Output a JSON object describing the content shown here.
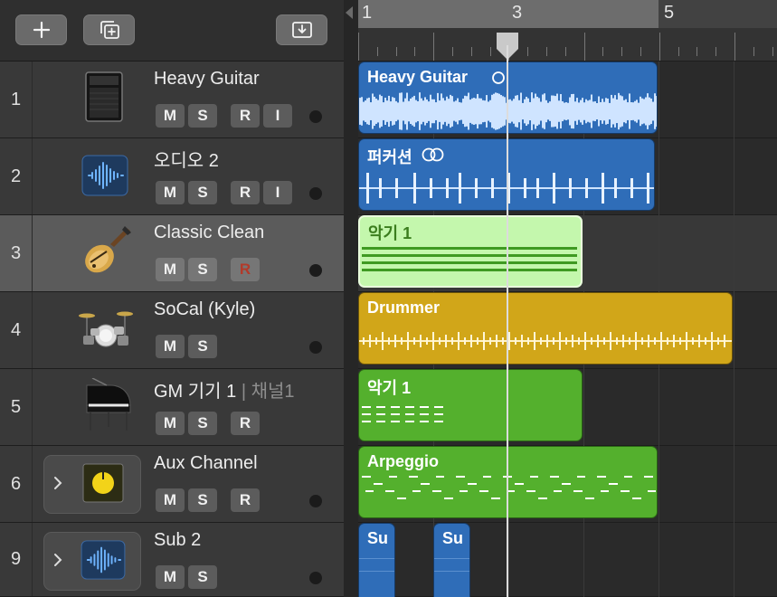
{
  "toolbar": {
    "add_track_icon": "plus-icon",
    "duplicate_track_icon": "duplicate-track-icon",
    "download_icon": "download-tray-icon"
  },
  "ruler": {
    "bars": [
      "1",
      "3",
      "5"
    ]
  },
  "tracks": [
    {
      "number": "1",
      "name": "Heavy Guitar",
      "subname": "",
      "icon": "amp-cabinet-icon",
      "buttons": [
        "M",
        "S",
        "R",
        "I"
      ],
      "armed": false
    },
    {
      "number": "2",
      "name": "오디오 2",
      "subname": "",
      "icon": "audio-waveform-icon",
      "buttons": [
        "M",
        "S",
        "R",
        "I"
      ],
      "armed": false
    },
    {
      "number": "3",
      "name": "Classic Clean",
      "subname": "",
      "icon": "electric-guitar-icon",
      "buttons": [
        "M",
        "S",
        "R"
      ],
      "armed": true
    },
    {
      "number": "4",
      "name": "SoCal (Kyle)",
      "subname": "",
      "icon": "drum-kit-icon",
      "buttons": [
        "M",
        "S"
      ],
      "armed": false
    },
    {
      "number": "5",
      "name": "GM 기기 1",
      "subname": " | 채널1",
      "icon": "grand-piano-icon",
      "buttons": [
        "M",
        "S",
        "R"
      ],
      "armed": false
    },
    {
      "number": "6",
      "name": "Aux Channel",
      "subname": "",
      "icon": "knob-icon",
      "buttons": [
        "M",
        "S",
        "R"
      ],
      "armed": false
    },
    {
      "number": "9",
      "name": "Sub 2",
      "subname": "",
      "icon": "audio-waveform-icon",
      "buttons": [
        "M",
        "S"
      ],
      "armed": false
    }
  ],
  "regions": [
    {
      "name": "Heavy Guitar",
      "type": "audio",
      "color": "#2f6db8"
    },
    {
      "name": "퍼커션",
      "type": "audio",
      "color": "#2f6db8"
    },
    {
      "name": "악기 1",
      "type": "midi",
      "color": "#bff7a6"
    },
    {
      "name": "Drummer",
      "type": "drummer",
      "color": "#d1a619"
    },
    {
      "name": "악기 1",
      "type": "midi",
      "color": "#54b02d"
    },
    {
      "name": "Arpeggio",
      "type": "midi",
      "color": "#54b02d"
    },
    {
      "name": "Su",
      "type": "audio",
      "color": "#2f6db8"
    },
    {
      "name": "Su",
      "type": "audio",
      "color": "#2f6db8"
    }
  ]
}
